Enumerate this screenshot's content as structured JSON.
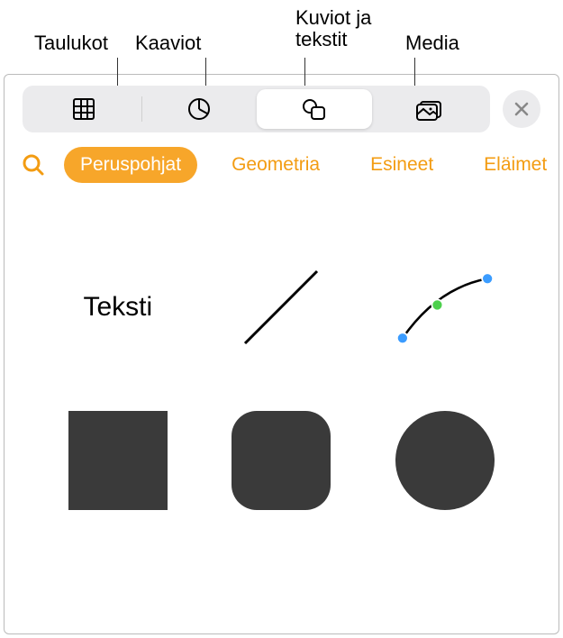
{
  "callouts": {
    "tables": "Taulukot",
    "charts": "Kaaviot",
    "shapes_text_line1": "Kuviot ja",
    "shapes_text_line2": "tekstit",
    "media": "Media"
  },
  "tabs": {
    "basics": "Peruspohjat",
    "geometry": "Geometria",
    "objects": "Esineet",
    "animals": "Eläimet"
  },
  "shapes": {
    "text_label": "Teksti"
  },
  "icons": {
    "tables": "tables-icon",
    "charts": "charts-icon",
    "shapes": "shapes-icon",
    "media": "media-icon",
    "close": "close-icon",
    "search": "search-icon"
  }
}
